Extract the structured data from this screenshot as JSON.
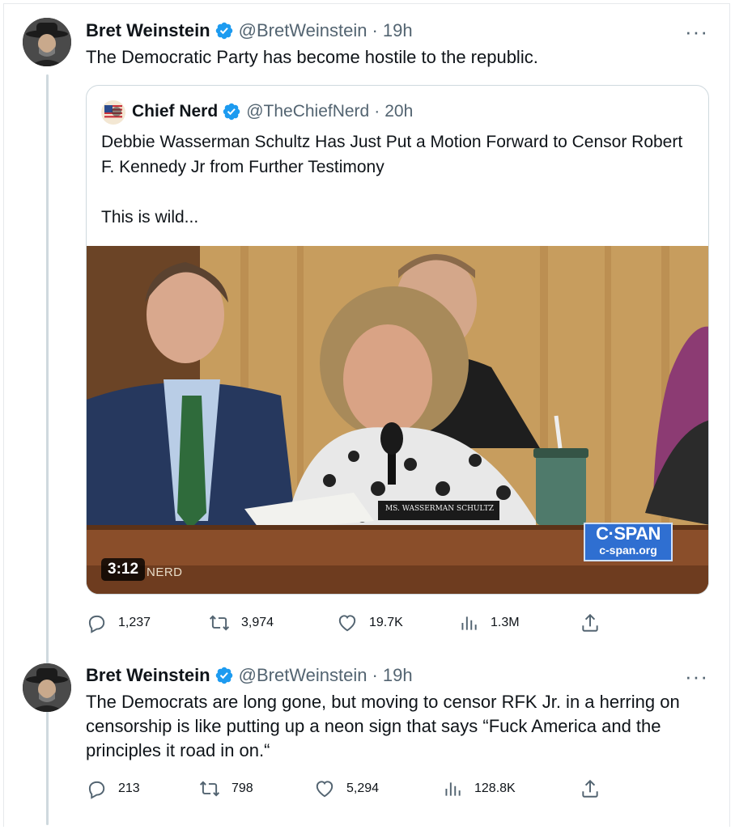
{
  "tweets": [
    {
      "author_name": "Bret Weinstein",
      "handle": "@BretWeinstein",
      "separator": "·",
      "time": "19h",
      "text": "The Democratic Party has become hostile to the republic.",
      "more": "···",
      "quote": {
        "author_name": "Chief Nerd",
        "handle": "@TheChiefNerd",
        "separator": "·",
        "time": "20h",
        "paragraphs": [
          "Debbie Wasserman Schultz Has Just Put a Motion Forward to Censor Robert F. Kennedy Jr from Further Testimony",
          "",
          "This is wild..."
        ],
        "video": {
          "duration": "3:12",
          "watermark": "NERD",
          "nameplate": "MS. WASSERMAN SCHULTZ",
          "network_logo": "C·SPAN",
          "network_url": "c-span.org"
        }
      },
      "stats": {
        "replies": "1,237",
        "reposts": "3,974",
        "likes": "19.7K",
        "views": "1.3M"
      }
    },
    {
      "author_name": "Bret Weinstein",
      "handle": "@BretWeinstein",
      "separator": "·",
      "time": "19h",
      "text_lines": [
        "The Democrats are long gone, but moving to censor RFK Jr. in a herring on",
        "censorship is like putting up a neon sign that says “Fuck America and the",
        "principles it road in on.“"
      ],
      "more": "···",
      "stats": {
        "replies": "213",
        "reposts": "798",
        "likes": "5,294",
        "views": "128.8K"
      }
    }
  ],
  "icons": {
    "verified": "verified-badge-icon",
    "reply": "reply-icon",
    "repost": "repost-icon",
    "like": "heart-icon",
    "views": "views-chart-icon",
    "share": "share-icon"
  },
  "colors": {
    "verified_blue": "#1d9bf0",
    "text_primary": "#0f1419",
    "text_secondary": "#536471",
    "border": "#cfd9de",
    "cspan_blue": "#2f6fd1"
  }
}
